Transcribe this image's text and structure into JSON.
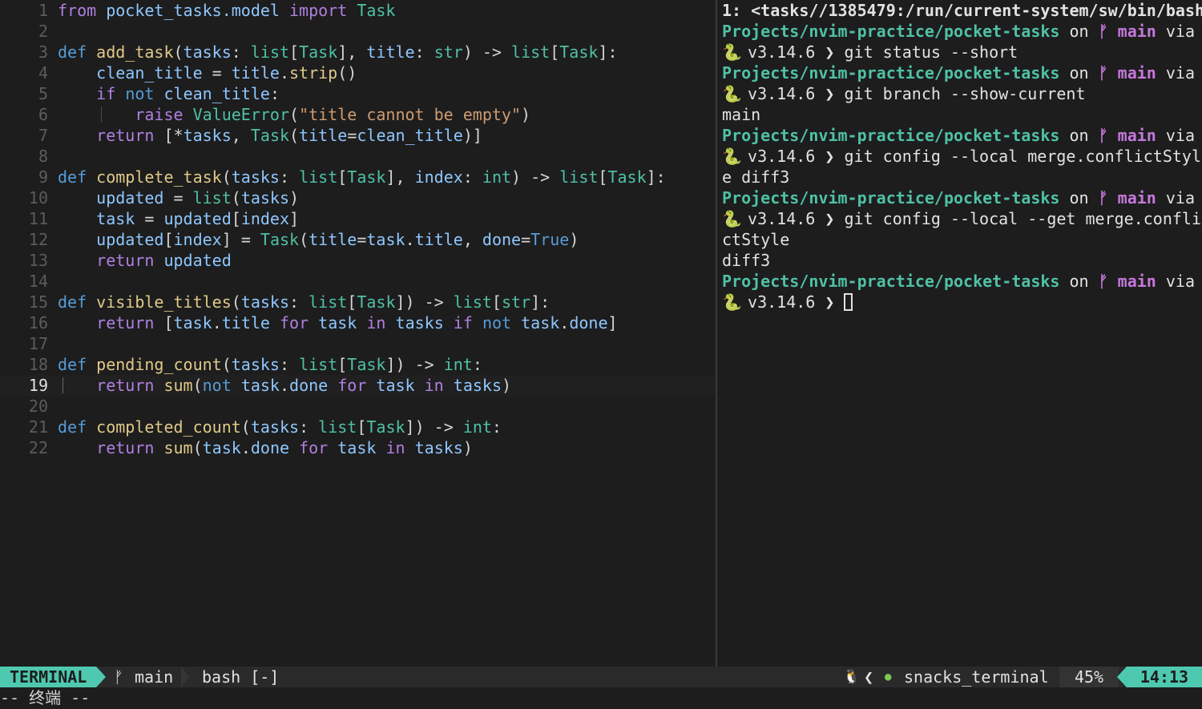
{
  "editor": {
    "lines": [
      {
        "n": "1",
        "t": [
          [
            "kw",
            "from"
          ],
          [
            "pun",
            " "
          ],
          [
            "var",
            "pocket_tasks.model"
          ],
          [
            "pun",
            " "
          ],
          [
            "kw",
            "import"
          ],
          [
            "pun",
            " "
          ],
          [
            "cls",
            "Task"
          ]
        ]
      },
      {
        "n": "2",
        "t": []
      },
      {
        "n": "3",
        "t": [
          [
            "def",
            "def"
          ],
          [
            "pun",
            " "
          ],
          [
            "fn",
            "add_task"
          ],
          [
            "pun",
            "("
          ],
          [
            "var",
            "tasks"
          ],
          [
            "pun",
            ": "
          ],
          [
            "ty",
            "list"
          ],
          [
            "pun",
            "["
          ],
          [
            "cls",
            "Task"
          ],
          [
            "pun",
            "], "
          ],
          [
            "var",
            "title"
          ],
          [
            "pun",
            ": "
          ],
          [
            "ty",
            "str"
          ],
          [
            "pun",
            ") -> "
          ],
          [
            "ty",
            "list"
          ],
          [
            "pun",
            "["
          ],
          [
            "cls",
            "Task"
          ],
          [
            "pun",
            "]:"
          ]
        ]
      },
      {
        "n": "4",
        "t": [
          [
            "pun",
            "    "
          ],
          [
            "var",
            "clean_title"
          ],
          [
            "op",
            " = "
          ],
          [
            "var",
            "title"
          ],
          [
            "pun",
            "."
          ],
          [
            "fn",
            "strip"
          ],
          [
            "pun",
            "()"
          ]
        ]
      },
      {
        "n": "5",
        "t": [
          [
            "pun",
            "    "
          ],
          [
            "kw",
            "if"
          ],
          [
            "pun",
            " "
          ],
          [
            "def",
            "not"
          ],
          [
            "pun",
            " "
          ],
          [
            "var",
            "clean_title"
          ],
          [
            "pun",
            ":"
          ]
        ]
      },
      {
        "n": "6",
        "t": [
          [
            "pun",
            "        "
          ],
          [
            "kw",
            "raise"
          ],
          [
            "pun",
            " "
          ],
          [
            "cls",
            "ValueError"
          ],
          [
            "pun",
            "("
          ],
          [
            "str",
            "\"title cannot be empty\""
          ],
          [
            "pun",
            ")"
          ]
        ]
      },
      {
        "n": "7",
        "t": [
          [
            "pun",
            "    "
          ],
          [
            "kw",
            "return"
          ],
          [
            "pun",
            " ["
          ],
          [
            "op",
            "*"
          ],
          [
            "var",
            "tasks"
          ],
          [
            "pun",
            ", "
          ],
          [
            "cls",
            "Task"
          ],
          [
            "pun",
            "("
          ],
          [
            "var",
            "title"
          ],
          [
            "op",
            "="
          ],
          [
            "var",
            "clean_title"
          ],
          [
            "pun",
            ")]"
          ]
        ]
      },
      {
        "n": "8",
        "t": []
      },
      {
        "n": "9",
        "t": [
          [
            "def",
            "def"
          ],
          [
            "pun",
            " "
          ],
          [
            "fn",
            "complete_task"
          ],
          [
            "pun",
            "("
          ],
          [
            "var",
            "tasks"
          ],
          [
            "pun",
            ": "
          ],
          [
            "ty",
            "list"
          ],
          [
            "pun",
            "["
          ],
          [
            "cls",
            "Task"
          ],
          [
            "pun",
            "], "
          ],
          [
            "var",
            "index"
          ],
          [
            "pun",
            ": "
          ],
          [
            "ty",
            "int"
          ],
          [
            "pun",
            ") -> "
          ],
          [
            "ty",
            "list"
          ],
          [
            "pun",
            "["
          ],
          [
            "cls",
            "Task"
          ],
          [
            "pun",
            "]:"
          ]
        ]
      },
      {
        "n": "10",
        "t": [
          [
            "pun",
            "    "
          ],
          [
            "var",
            "updated"
          ],
          [
            "op",
            " = "
          ],
          [
            "ty",
            "list"
          ],
          [
            "pun",
            "("
          ],
          [
            "var",
            "tasks"
          ],
          [
            "pun",
            ")"
          ]
        ]
      },
      {
        "n": "11",
        "t": [
          [
            "pun",
            "    "
          ],
          [
            "var",
            "task"
          ],
          [
            "op",
            " = "
          ],
          [
            "var",
            "updated"
          ],
          [
            "pun",
            "["
          ],
          [
            "var",
            "index"
          ],
          [
            "pun",
            "]"
          ]
        ]
      },
      {
        "n": "12",
        "t": [
          [
            "pun",
            "    "
          ],
          [
            "var",
            "updated"
          ],
          [
            "pun",
            "["
          ],
          [
            "var",
            "index"
          ],
          [
            "pun",
            "]"
          ],
          [
            "op",
            " = "
          ],
          [
            "cls",
            "Task"
          ],
          [
            "pun",
            "("
          ],
          [
            "var",
            "title"
          ],
          [
            "op",
            "="
          ],
          [
            "var",
            "task"
          ],
          [
            "pun",
            "."
          ],
          [
            "var",
            "title"
          ],
          [
            "pun",
            ", "
          ],
          [
            "var",
            "done"
          ],
          [
            "op",
            "="
          ],
          [
            "bool",
            "True"
          ],
          [
            "pun",
            ")"
          ]
        ]
      },
      {
        "n": "13",
        "t": [
          [
            "pun",
            "    "
          ],
          [
            "kw",
            "return"
          ],
          [
            "pun",
            " "
          ],
          [
            "var",
            "updated"
          ]
        ]
      },
      {
        "n": "14",
        "t": []
      },
      {
        "n": "15",
        "t": [
          [
            "def",
            "def"
          ],
          [
            "pun",
            " "
          ],
          [
            "fn",
            "visible_titles"
          ],
          [
            "pun",
            "("
          ],
          [
            "var",
            "tasks"
          ],
          [
            "pun",
            ": "
          ],
          [
            "ty",
            "list"
          ],
          [
            "pun",
            "["
          ],
          [
            "cls",
            "Task"
          ],
          [
            "pun",
            "]) -> "
          ],
          [
            "ty",
            "list"
          ],
          [
            "pun",
            "["
          ],
          [
            "ty",
            "str"
          ],
          [
            "pun",
            "]:"
          ]
        ]
      },
      {
        "n": "16",
        "t": [
          [
            "pun",
            "    "
          ],
          [
            "kw",
            "return"
          ],
          [
            "pun",
            " ["
          ],
          [
            "var",
            "task"
          ],
          [
            "pun",
            "."
          ],
          [
            "var",
            "title"
          ],
          [
            "pun",
            " "
          ],
          [
            "kw",
            "for"
          ],
          [
            "pun",
            " "
          ],
          [
            "var",
            "task"
          ],
          [
            "pun",
            " "
          ],
          [
            "kw",
            "in"
          ],
          [
            "pun",
            " "
          ],
          [
            "var",
            "tasks"
          ],
          [
            "pun",
            " "
          ],
          [
            "kw",
            "if"
          ],
          [
            "pun",
            " "
          ],
          [
            "def",
            "not"
          ],
          [
            "pun",
            " "
          ],
          [
            "var",
            "task"
          ],
          [
            "pun",
            "."
          ],
          [
            "var",
            "done"
          ],
          [
            "pun",
            "]"
          ]
        ]
      },
      {
        "n": "17",
        "t": []
      },
      {
        "n": "18",
        "t": [
          [
            "def",
            "def"
          ],
          [
            "pun",
            " "
          ],
          [
            "fn",
            "pending_count"
          ],
          [
            "pun",
            "("
          ],
          [
            "var",
            "tasks"
          ],
          [
            "pun",
            ": "
          ],
          [
            "ty",
            "list"
          ],
          [
            "pun",
            "["
          ],
          [
            "cls",
            "Task"
          ],
          [
            "pun",
            "]) -> "
          ],
          [
            "ty",
            "int"
          ],
          [
            "pun",
            ":"
          ]
        ]
      },
      {
        "n": "19",
        "t": [
          [
            "pun",
            "    "
          ],
          [
            "kw",
            "return"
          ],
          [
            "pun",
            " "
          ],
          [
            "fn",
            "sum"
          ],
          [
            "pun",
            "("
          ],
          [
            "def",
            "not"
          ],
          [
            "pun",
            " "
          ],
          [
            "var",
            "task"
          ],
          [
            "pun",
            "."
          ],
          [
            "var",
            "done"
          ],
          [
            "pun",
            " "
          ],
          [
            "kw",
            "for"
          ],
          [
            "pun",
            " "
          ],
          [
            "var",
            "task"
          ],
          [
            "pun",
            " "
          ],
          [
            "kw",
            "in"
          ],
          [
            "pun",
            " "
          ],
          [
            "var",
            "tasks"
          ],
          [
            "pun",
            ")"
          ]
        ],
        "current": true
      },
      {
        "n": "20",
        "t": []
      },
      {
        "n": "21",
        "t": [
          [
            "def",
            "def"
          ],
          [
            "pun",
            " "
          ],
          [
            "fn",
            "completed_count"
          ],
          [
            "pun",
            "("
          ],
          [
            "var",
            "tasks"
          ],
          [
            "pun",
            ": "
          ],
          [
            "ty",
            "list"
          ],
          [
            "pun",
            "["
          ],
          [
            "cls",
            "Task"
          ],
          [
            "pun",
            "]) -> "
          ],
          [
            "ty",
            "int"
          ],
          [
            "pun",
            ":"
          ]
        ]
      },
      {
        "n": "22",
        "t": [
          [
            "pun",
            "    "
          ],
          [
            "kw",
            "return"
          ],
          [
            "pun",
            " "
          ],
          [
            "fn",
            "sum"
          ],
          [
            "pun",
            "("
          ],
          [
            "var",
            "task"
          ],
          [
            "pun",
            "."
          ],
          [
            "var",
            "done"
          ],
          [
            "pun",
            " "
          ],
          [
            "kw",
            "for"
          ],
          [
            "pun",
            " "
          ],
          [
            "var",
            "task"
          ],
          [
            "pun",
            " "
          ],
          [
            "kw",
            "in"
          ],
          [
            "pun",
            " "
          ],
          [
            "var",
            "tasks"
          ],
          [
            "pun",
            ")"
          ]
        ]
      }
    ]
  },
  "terminal": {
    "title": "1: <tasks//1385479:/run/current-system/sw/bin/bash",
    "prompt_path": "Projects/nvim-practice/pocket-tasks",
    "prompt_on": " on ",
    "branch_icon": "ᚠ",
    "prompt_branch": "main",
    "prompt_via": " via",
    "python_icon": "🐍",
    "python_version": "v3.14.6",
    "prompt_arrow": "❯",
    "lines": [
      {
        "kind": "title"
      },
      {
        "kind": "prompt1"
      },
      {
        "kind": "prompt2",
        "cmd": "git status --short"
      },
      {
        "kind": "prompt1"
      },
      {
        "kind": "prompt2",
        "cmd": "git branch --show-current"
      },
      {
        "kind": "out",
        "text": "main"
      },
      {
        "kind": "prompt1"
      },
      {
        "kind": "prompt2",
        "cmd": "git config --local merge.conflictStyl"
      },
      {
        "kind": "out",
        "text": "e diff3"
      },
      {
        "kind": "prompt1"
      },
      {
        "kind": "prompt2",
        "cmd": "git config --local --get merge.confli"
      },
      {
        "kind": "out",
        "text": "ctStyle"
      },
      {
        "kind": "out",
        "text": "diff3"
      },
      {
        "kind": "prompt1"
      },
      {
        "kind": "prompt2",
        "cmd": "",
        "cursor": true
      }
    ]
  },
  "statusbar": {
    "mode": "TERMINAL",
    "branch_icon": "ᚠ",
    "branch": "main",
    "buffer": "bash [-]",
    "linux_icon": "🐧",
    "chevron": "❮",
    "ft_icon": "●",
    "filetype": "snacks_terminal",
    "percent": "45%",
    "time": "14:13"
  },
  "cmdline": {
    "text": "-- 终端 --"
  },
  "colors": {
    "accent": "#4ec9b0",
    "branch": "#c678dd",
    "background": "#1d1d1d"
  }
}
